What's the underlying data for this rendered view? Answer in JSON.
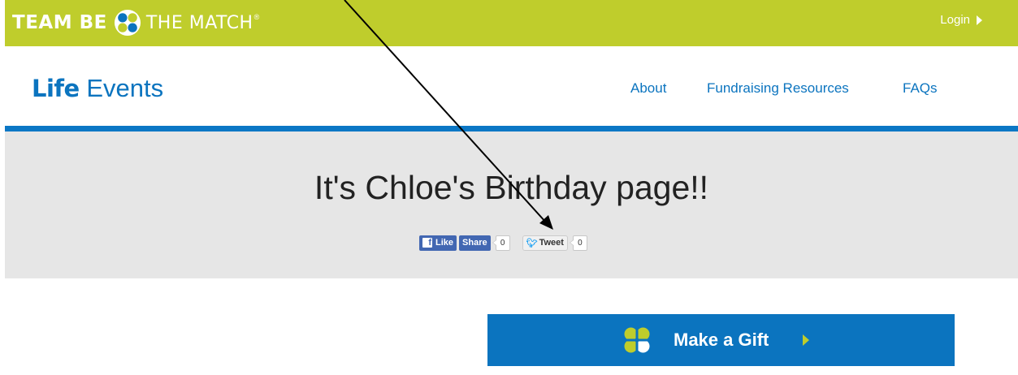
{
  "topbar": {
    "brand_team": "TEAM BE",
    "brand_match": "THE MATCH",
    "brand_mark": "®",
    "login_label": "Login",
    "background_color": "#bfcd2c"
  },
  "nav": {
    "site_title_bold": "Life",
    "site_title_light": "Events",
    "items": [
      {
        "label": "About"
      },
      {
        "label": "Fundraising Resources"
      },
      {
        "label": "FAQs"
      }
    ],
    "accent_color": "#0b74bf"
  },
  "hero": {
    "title": "It's Chloe's Birthday page!!",
    "share": {
      "like_label": "Like",
      "share_label": "Share",
      "facebook_count": "0",
      "tweet_label": "Tweet",
      "tweet_count": "0"
    }
  },
  "cta": {
    "label": "Make a Gift",
    "icon": "be-the-match-logo-icon"
  },
  "icons": {
    "login_caret": "caret-right-icon",
    "facebook": "facebook-icon",
    "twitter": "twitter-bird-icon",
    "annotation": "annotation-arrow"
  }
}
